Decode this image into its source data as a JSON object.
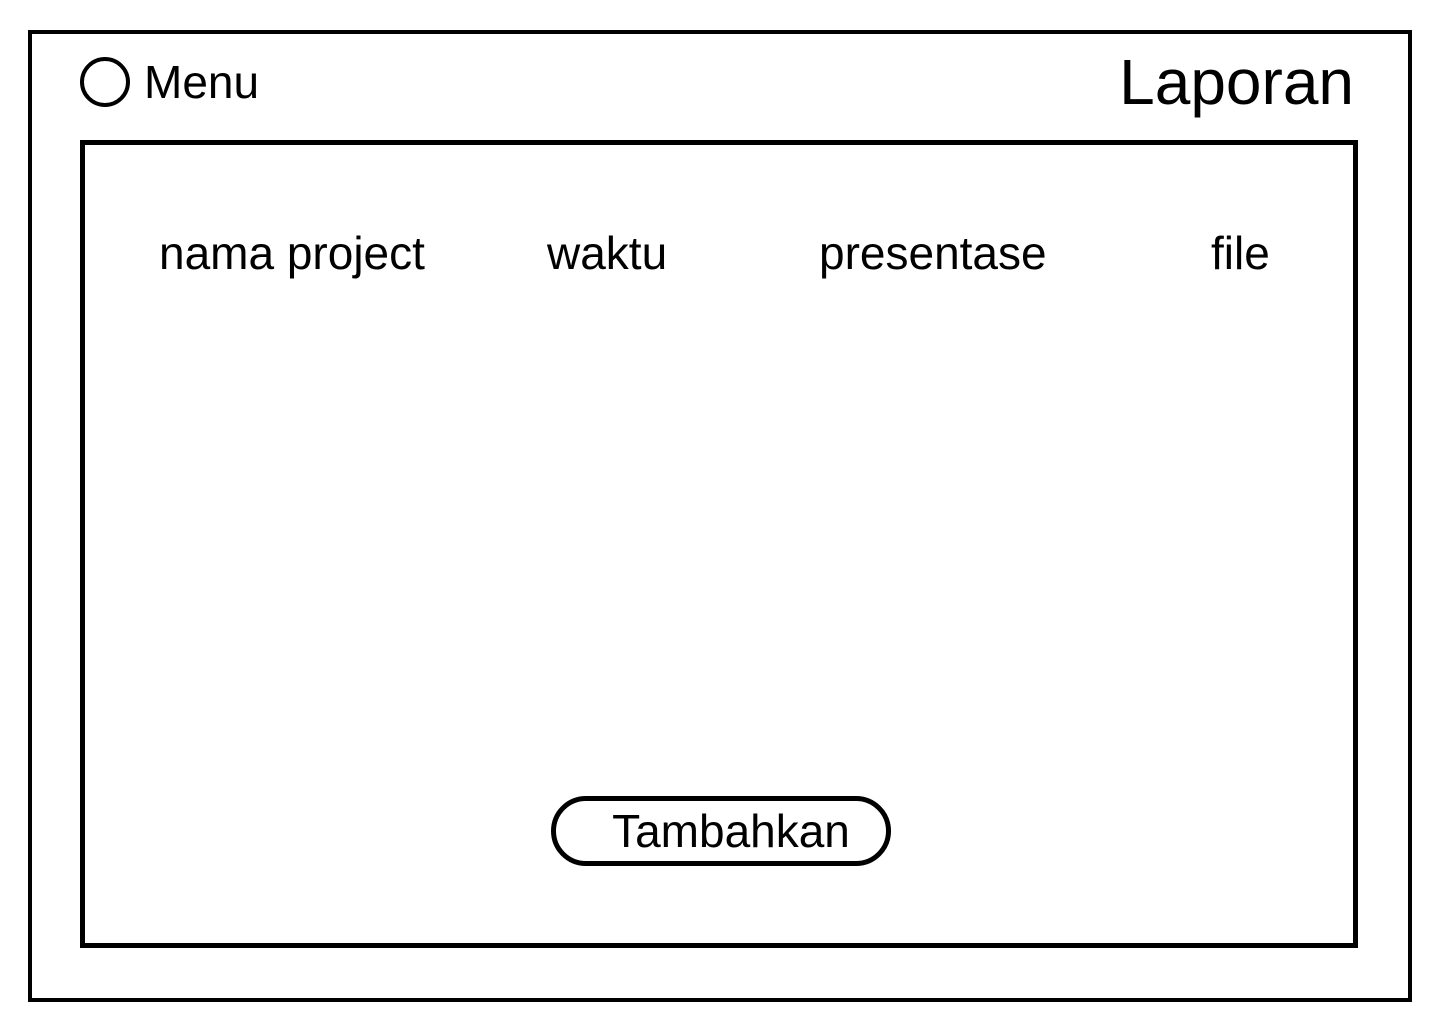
{
  "header": {
    "menu_label": "Menu",
    "menu_icon": "circle-icon",
    "title": "Laporan"
  },
  "table": {
    "columns": [
      "nama project",
      "waktu",
      "presentase",
      "file"
    ],
    "rows": []
  },
  "actions": {
    "add_label": "Tambahkan"
  },
  "colors": {
    "stroke": "#000000",
    "background": "#ffffff"
  }
}
